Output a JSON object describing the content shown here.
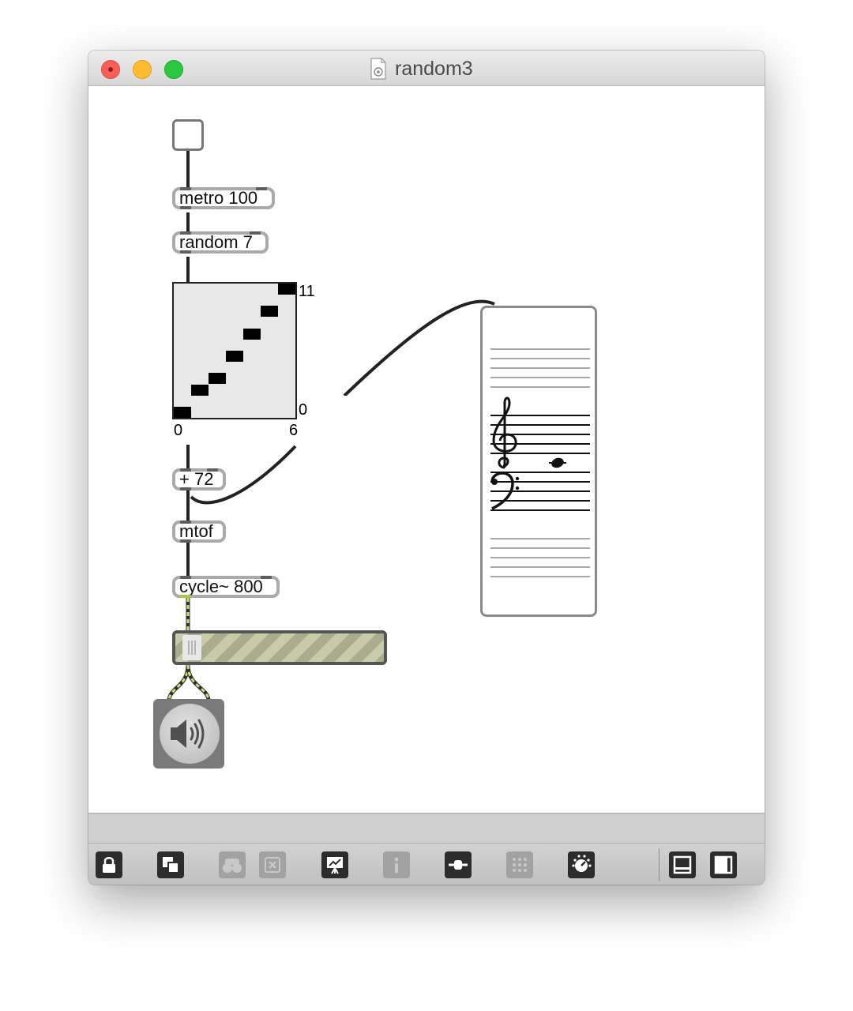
{
  "window": {
    "title": "random3"
  },
  "objects": {
    "metro": "metro 100",
    "random": "random 7",
    "plus": "+ 72",
    "mtof": "mtof",
    "cycle": "cycle~ 800"
  },
  "multislider": {
    "y_max_label": "11",
    "y_min_label": "0",
    "x_min_label": "0",
    "x_max_label": "6",
    "values": [
      0,
      2,
      3,
      5,
      7,
      9,
      11
    ]
  },
  "nslider": {
    "clefs": [
      "treble-clef",
      "bass-clef"
    ],
    "note_midi": 60
  },
  "gain": {
    "level": 0.02
  },
  "toolbar": {
    "buttons": [
      {
        "icon": "lock-icon",
        "enabled": true
      },
      {
        "icon": "presentation-toggle-icon",
        "enabled": true
      },
      {
        "icon": "binoculars-icon",
        "enabled": false
      },
      {
        "icon": "clear-icon",
        "enabled": false
      },
      {
        "icon": "presentation-icon",
        "enabled": true
      },
      {
        "icon": "inspector-icon",
        "enabled": false
      },
      {
        "icon": "slider-icon",
        "enabled": true
      },
      {
        "icon": "grid-icon",
        "enabled": false
      },
      {
        "icon": "audio-dial-icon",
        "enabled": true
      },
      {
        "icon": "bottom-panel-icon",
        "enabled": true
      },
      {
        "icon": "sidebar-icon",
        "enabled": true
      }
    ]
  }
}
